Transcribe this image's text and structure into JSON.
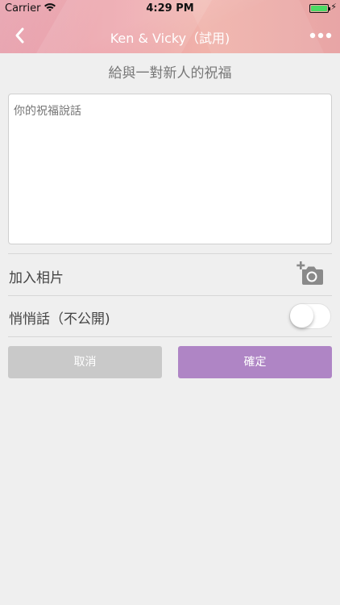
{
  "status_bar": {
    "carrier": "Carrier",
    "time": "4:29 PM"
  },
  "navbar": {
    "title": "Ken & Vicky（試用)",
    "back_icon": "chevron-left-icon",
    "more_icon": "ellipsis-icon"
  },
  "form": {
    "subtitle": "給與一對新人的祝福",
    "message_placeholder": "你的祝福說話",
    "add_photo_label": "加入相片",
    "add_photo_icon": "add-photo-camera-icon",
    "private_label": "悄悄話（不公開)",
    "private_enabled": false,
    "cancel_label": "取消",
    "confirm_label": "確定"
  },
  "colors": {
    "confirm_button": "#af85c5",
    "cancel_button": "#c9c9c9",
    "background": "#efefef",
    "battery": "#4cd964"
  }
}
